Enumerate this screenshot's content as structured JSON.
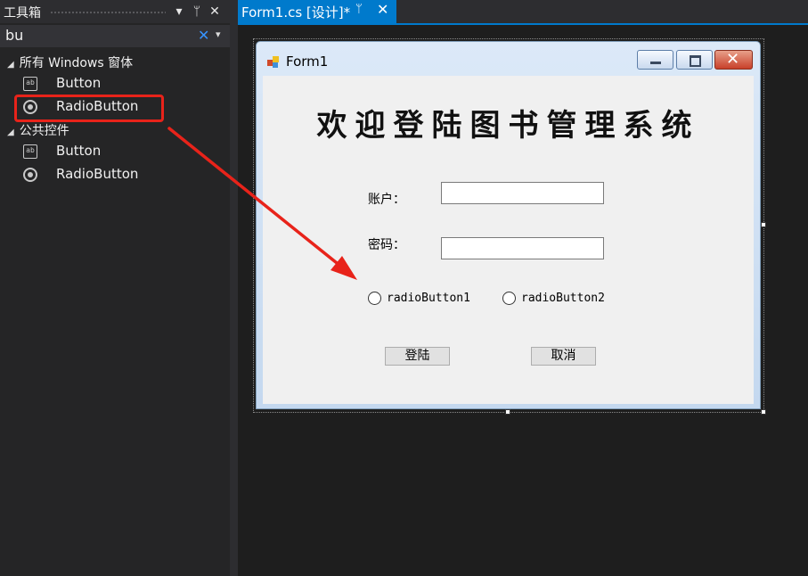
{
  "toolbox": {
    "title": "工具箱",
    "buttons": [
      "▾",
      "ᛘ",
      "✕"
    ],
    "search": {
      "value": "bu",
      "clear": "✕",
      "dropdown": "▾"
    },
    "groups": [
      {
        "label": "所有 Windows 窗体",
        "items": [
          {
            "label": "Button",
            "icon": "button-icon"
          },
          {
            "label": "RadioButton",
            "icon": "radio-button-icon"
          }
        ]
      },
      {
        "label": "公共控件",
        "items": [
          {
            "label": "Button",
            "icon": "button-icon"
          },
          {
            "label": "RadioButton",
            "icon": "radio-button-icon"
          }
        ]
      }
    ]
  },
  "tab": {
    "label": "Form1.cs [设计]*",
    "pin": "ᛘ",
    "close": "✕"
  },
  "form": {
    "title": "Form1",
    "heading": "欢迎登陆图书管理系统",
    "account_label": "账户：",
    "password_label": "密码：",
    "account_value": "",
    "password_value": "",
    "radio1": "radioButton1",
    "radio2": "radioButton2",
    "login_button": "登陆",
    "cancel_button": "取消",
    "close_glyph": "✕"
  },
  "colors": {
    "accent": "#007acc",
    "highlight": "#e8231a",
    "background": "#1e1e1e"
  }
}
